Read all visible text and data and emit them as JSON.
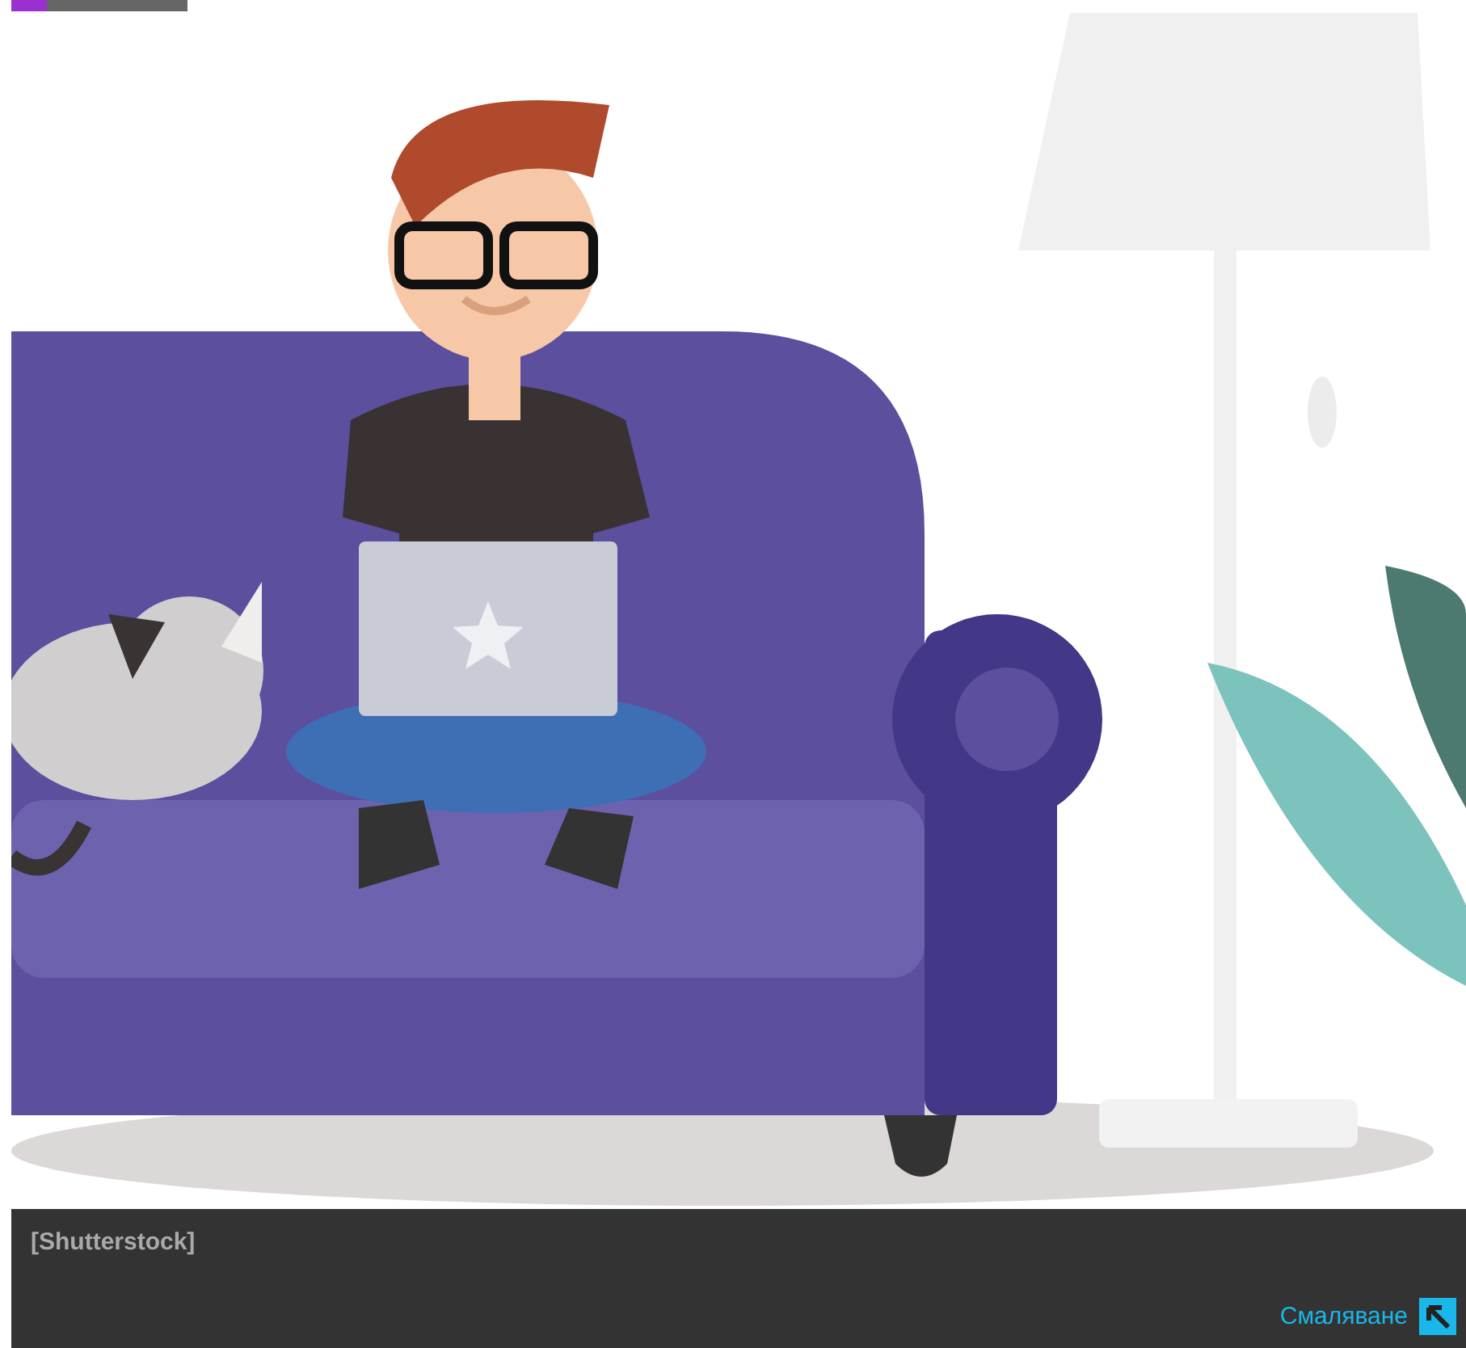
{
  "image": {
    "credit": "[Shutterstock]"
  },
  "caption_bar": {
    "shrink_link": "Смаляване"
  }
}
